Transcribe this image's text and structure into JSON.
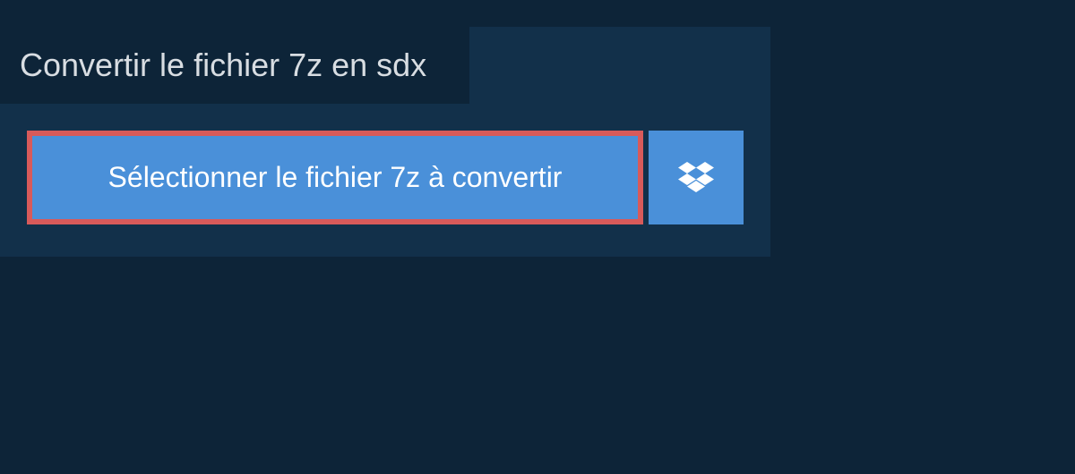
{
  "title": "Convertir le fichier 7z en sdx",
  "buttons": {
    "select_file": "Sélectionner le fichier 7z à convertir"
  }
}
